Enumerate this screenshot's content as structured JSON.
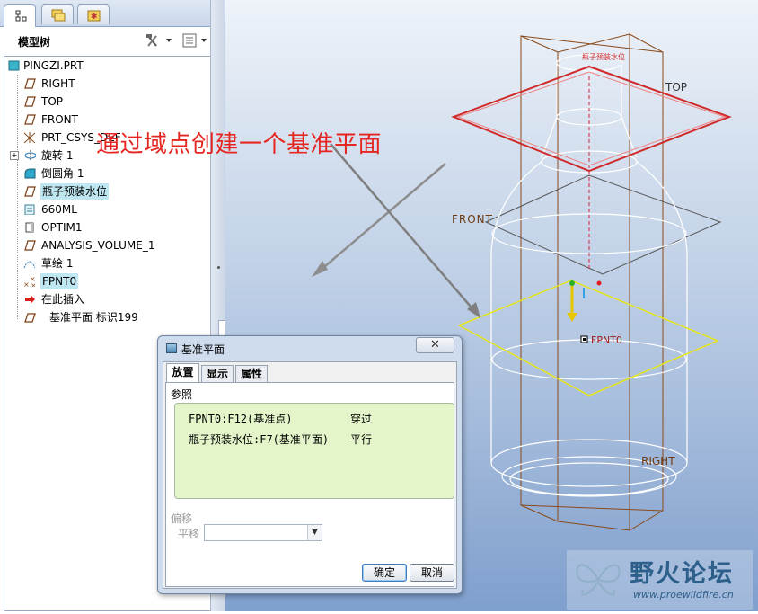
{
  "left_panel": {
    "title": "模型树",
    "tree": [
      {
        "label": "PINGZI.PRT",
        "icon": "part-icon"
      },
      {
        "label": "RIGHT",
        "icon": "datum-plane-icon"
      },
      {
        "label": "TOP",
        "icon": "datum-plane-icon"
      },
      {
        "label": "FRONT",
        "icon": "datum-plane-icon"
      },
      {
        "label": "PRT_CSYS_DEF",
        "icon": "csys-icon"
      },
      {
        "label": "旋转 1",
        "icon": "revolve-icon"
      },
      {
        "label": "倒圆角 1",
        "icon": "round-icon"
      },
      {
        "label": "瓶子预装水位",
        "icon": "datum-plane-icon"
      },
      {
        "label": "660ML",
        "icon": "feature-icon"
      },
      {
        "label": "OPTIM1",
        "icon": "optim-icon"
      },
      {
        "label": "ANALYSIS_VOLUME_1",
        "icon": "datum-plane-icon"
      },
      {
        "label": "草绘 1",
        "icon": "sketch-icon"
      },
      {
        "label": "FPNT0",
        "icon": "datum-point-icon"
      },
      {
        "label": "在此插入",
        "icon": "insert-arrow-icon"
      },
      {
        "label": "基准平面 标识199",
        "icon": "new-datum-plane-icon"
      }
    ]
  },
  "annotation": "通过域点创建一个基准平面",
  "viewport": {
    "labels": {
      "top": "TOP",
      "front": "FRONT",
      "right": "RIGHT",
      "point": "FPNT0",
      "plane": "瓶子预装水位"
    }
  },
  "dialog": {
    "title": "基准平面",
    "close": "✕",
    "tabs": [
      "放置",
      "显示",
      "属性"
    ],
    "ref_label": "参照",
    "references": [
      {
        "ref": "FPNT0:F12(基准点)",
        "constraint": "穿过"
      },
      {
        "ref": "瓶子预装水位:F7(基准平面)",
        "constraint": "平行"
      }
    ],
    "offset_label": "偏移",
    "translate_label": "平移",
    "translate_value": "",
    "ok": "确定",
    "cancel": "取消"
  },
  "watermark": {
    "title": "野火论坛",
    "url": "www.proewildfire.cn"
  },
  "colors": {
    "annotation": "#e52620",
    "highlight": "#bfe7f1",
    "viewport_bottom": "#7f9fcd",
    "ref_box": "#e3f5c9"
  }
}
